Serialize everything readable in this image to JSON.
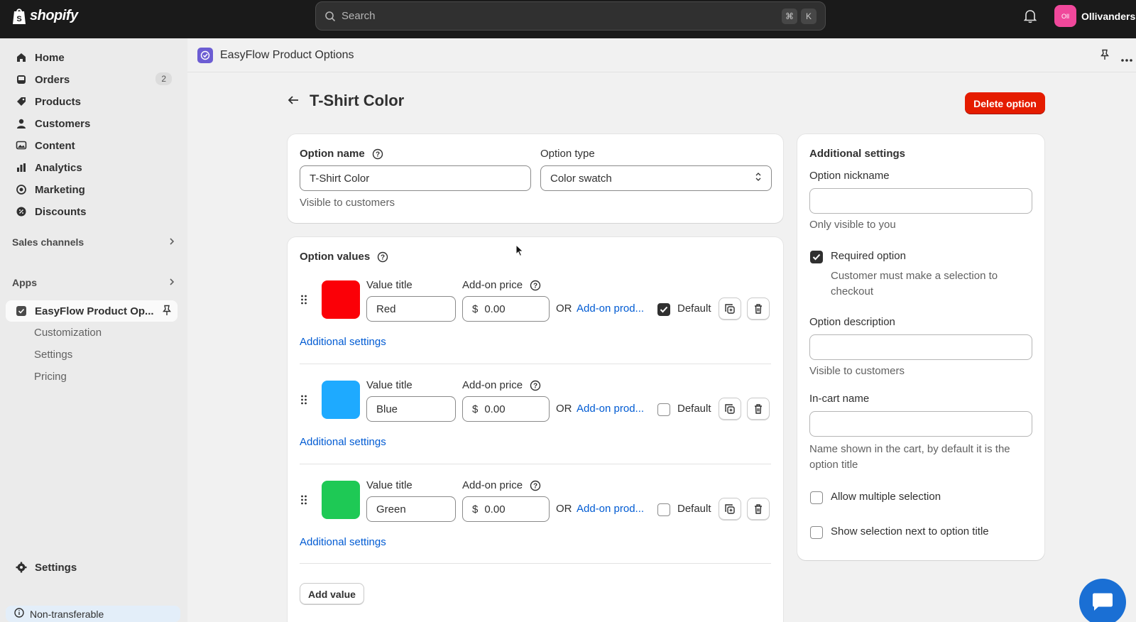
{
  "topbar": {
    "brand": "shopify",
    "search_placeholder": "Search",
    "shortcut_cmd": "⌘",
    "shortcut_key": "K",
    "store_initials": "Oll",
    "store_name": "Ollivanders"
  },
  "sidebar": {
    "items": [
      {
        "label": "Home",
        "icon": "home-icon"
      },
      {
        "label": "Orders",
        "icon": "orders-icon",
        "badge": "2"
      },
      {
        "label": "Products",
        "icon": "tag-icon"
      },
      {
        "label": "Customers",
        "icon": "person-icon"
      },
      {
        "label": "Content",
        "icon": "image-icon"
      },
      {
        "label": "Analytics",
        "icon": "bar-chart-icon"
      },
      {
        "label": "Marketing",
        "icon": "target-icon"
      },
      {
        "label": "Discounts",
        "icon": "discount-icon"
      }
    ],
    "sales_channels": "Sales channels",
    "apps": "Apps",
    "app_active": "EasyFlow Product Op...",
    "app_sub": [
      "Customization",
      "Settings",
      "Pricing"
    ],
    "settings": "Settings",
    "non_transferable": "Non-transferable"
  },
  "app_header": {
    "title": "EasyFlow Product Options"
  },
  "page": {
    "title": "T-Shirt Color",
    "delete_label": "Delete option"
  },
  "option_card": {
    "name_label": "Option name",
    "name_value": "T-Shirt Color",
    "name_help": "Visible to customers",
    "type_label": "Option type",
    "type_value": "Color swatch"
  },
  "values_card": {
    "title": "Option values",
    "value_title_label": "Value title",
    "addon_price_label": "Add-on price",
    "or_label": "OR",
    "addon_product_label": "Add-on prod...",
    "default_label": "Default",
    "additional_settings": "Additional settings",
    "currency": "$",
    "add_value": "Add value",
    "values": [
      {
        "title": "Red",
        "price": "0.00",
        "color": "#fb0007",
        "default": true
      },
      {
        "title": "Blue",
        "price": "0.00",
        "color": "#1eaaff",
        "default": false
      },
      {
        "title": "Green",
        "price": "0.00",
        "color": "#1ec955",
        "default": false
      }
    ]
  },
  "settings_card": {
    "title": "Additional settings",
    "nickname_label": "Option nickname",
    "nickname_help": "Only visible to you",
    "required_label": "Required option",
    "required_help": "Customer must make a selection to checkout",
    "required_checked": true,
    "description_label": "Option description",
    "description_help": "Visible to customers",
    "incart_label": "In-cart name",
    "incart_help": "Name shown in the cart, by default it is the option title",
    "multiple_label": "Allow multiple selection",
    "show_selection_label": "Show selection next to option title"
  }
}
